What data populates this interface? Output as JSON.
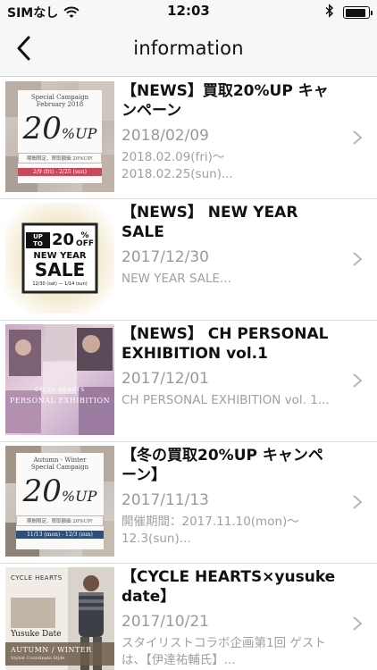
{
  "status_bar": {
    "carrier": "SIMなし",
    "time": "12:03",
    "battery_level": 0.9
  },
  "nav": {
    "title": "information",
    "back_icon": "chevron-left-icon"
  },
  "items": [
    {
      "title": "【NEWS】買取20%UP キャンペーン",
      "date": "2018/02/09",
      "desc": "2018.02.09(fri)〜 2018.02.25(sun)...",
      "thumb": {
        "line1": "Special Campaign",
        "line2": "February 2018",
        "big": "20",
        "big_suffix": "%UP",
        "sub": "期間限定、買取額価 20%UP!",
        "period": "2/9 (fri) - 2/25 (sun)"
      }
    },
    {
      "title": "【NEWS】 NEW YEAR SALE",
      "date": "2017/12/30",
      "desc": "NEW YEAR SALE...",
      "thumb": {
        "up_to": "UP TO",
        "pct": "20",
        "pct_unit": "%",
        "off": "OFF",
        "new_year": "NEW YEAR",
        "sale": "SALE",
        "period": "12/30 (sat) — 1/14 (sun)"
      }
    },
    {
      "title": "【NEWS】 CH PERSONAL EXHIBITION vol.1",
      "date": "2017/12/01",
      "desc": "CH PERSONAL EXHIBITION vol. 1...",
      "thumb": {
        "brand": "CYCLE HEARTS",
        "caption": "PERSONAL EXHIBITION"
      }
    },
    {
      "title": "【冬の買取20%UP キャンペーン】",
      "date": "2017/11/13",
      "desc": "開催期間：2017.11.10(mon)〜 12.3(sun)...",
      "thumb": {
        "line1": "Autumn - Winter",
        "line2": "Special Campaign",
        "big": "20",
        "big_suffix": "%UP",
        "sub": "期間限定、買取額価 20%UP!",
        "period": "11/13 (mon) - 12/3 (sun)"
      }
    },
    {
      "title": "【CYCLE HEARTS×yusuke date】",
      "date": "2017/10/21",
      "desc": "スタイリストコラボ企画第1回 ゲストは、【伊達祐輔氏】...",
      "thumb": {
        "brand": "CYCLE HEARTS",
        "name": "Yusuke Date",
        "season": "AUTUMN / WINTER",
        "sub": "Stylist Coordinate Style"
      }
    }
  ]
}
